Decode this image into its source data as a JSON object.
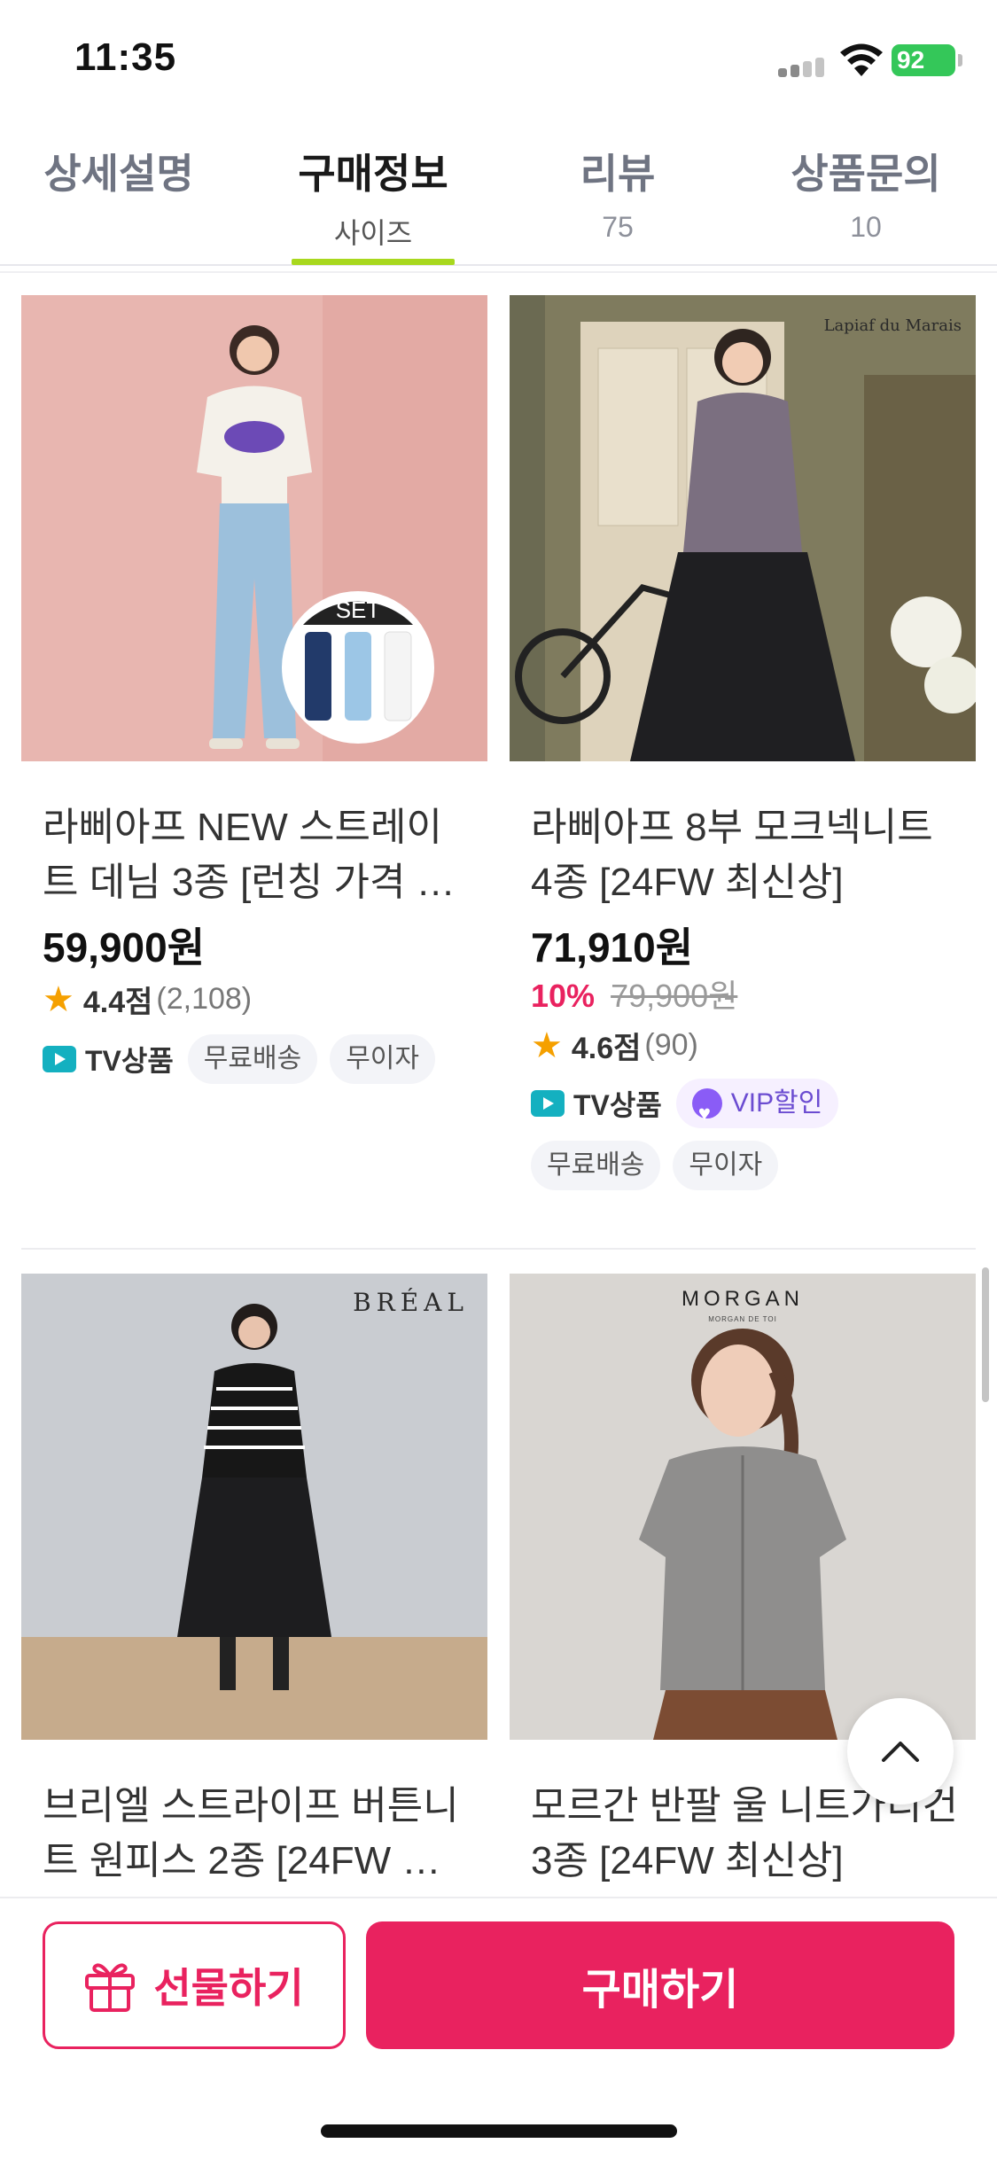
{
  "status_bar": {
    "time": "11:35",
    "battery": "92"
  },
  "tabs": [
    {
      "label": "상세설명",
      "sub": ""
    },
    {
      "label": "구매정보",
      "sub": "사이즈"
    },
    {
      "label": "리뷰",
      "sub": "75"
    },
    {
      "label": "상품문의",
      "sub": "10"
    }
  ],
  "active_tab": "구매정보",
  "products": [
    {
      "title": "라삐아프 NEW 스트레이트 데님 3종 [런칭 가격 …",
      "price": "59,900원",
      "badge": "SET",
      "rating": "4.4점",
      "reviews": "(2,108)",
      "tags": [
        "TV상품",
        "무료배송",
        "무이자"
      ]
    },
    {
      "title": "라삐아프 8부 모크넥니트 4종 [24FW 최신상]",
      "price": "71,910원",
      "discount": "10%",
      "original_price": "79,900원",
      "watermark": "Lapiaf du Marais",
      "rating": "4.6점",
      "reviews": "(90)",
      "tags": [
        "TV상품",
        "VIP할인",
        "무료배송",
        "무이자"
      ]
    },
    {
      "title": "브리엘 스트라이프 버튼니트 원피스 2종 [24FW …",
      "brand_logo": "BRÉAL"
    },
    {
      "title": "모르간 반팔 울 니트가디건 3종 [24FW 최신상]",
      "brand_logo": "MORGAN",
      "brand_sub": "MORGAN DE TOI"
    }
  ],
  "bottom_bar": {
    "gift_label": "선물하기",
    "buy_label": "구매하기"
  },
  "colors": {
    "accent": "#e9225f",
    "tab_indicator": "#a8d81e",
    "tv_badge": "#14b0c0",
    "vip": "#8a5cf6",
    "star": "#f5a000"
  },
  "icons": [
    "gift-icon",
    "tv-icon",
    "vip-heart-icon",
    "star-icon",
    "chevron-up-icon",
    "wifi-icon",
    "signal-icon",
    "battery-icon"
  ]
}
